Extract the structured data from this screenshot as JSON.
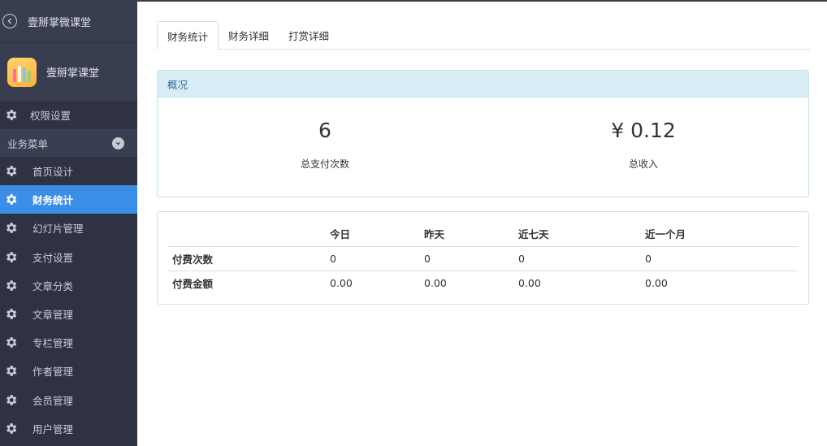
{
  "sidebar": {
    "top_title": "壹掰掌微课堂",
    "brand_name": "壹掰掌课堂",
    "permission_label": "权限设置",
    "group_label": "业务菜单",
    "items": [
      {
        "label": "首页设计"
      },
      {
        "label": "财务统计",
        "active": true
      },
      {
        "label": "幻灯片管理"
      },
      {
        "label": "支付设置"
      },
      {
        "label": "文章分类"
      },
      {
        "label": "文章管理"
      },
      {
        "label": "专栏管理"
      },
      {
        "label": "作者管理"
      },
      {
        "label": "会员管理"
      },
      {
        "label": "用户管理"
      }
    ]
  },
  "tabs": [
    {
      "label": "财务统计",
      "active": true
    },
    {
      "label": "财务详细"
    },
    {
      "label": "打赏详细"
    }
  ],
  "overview": {
    "title": "概况",
    "payment_count": "6",
    "payment_count_label": "总支付次数",
    "income": "¥ 0.12",
    "income_label": "总收入"
  },
  "table": {
    "columns": [
      "",
      "今日",
      "昨天",
      "近七天",
      "近一个月"
    ],
    "rows": [
      {
        "label": "付费次数",
        "values": [
          "0",
          "0",
          "0",
          "0"
        ]
      },
      {
        "label": "付费金额",
        "values": [
          "0.00",
          "0.00",
          "0.00",
          "0.00"
        ]
      }
    ]
  },
  "colors": {
    "sidebar_bg": "#2f3243",
    "active_item": "#3a8ee6",
    "info_header": "#d9edf7",
    "info_text": "#31708f"
  }
}
